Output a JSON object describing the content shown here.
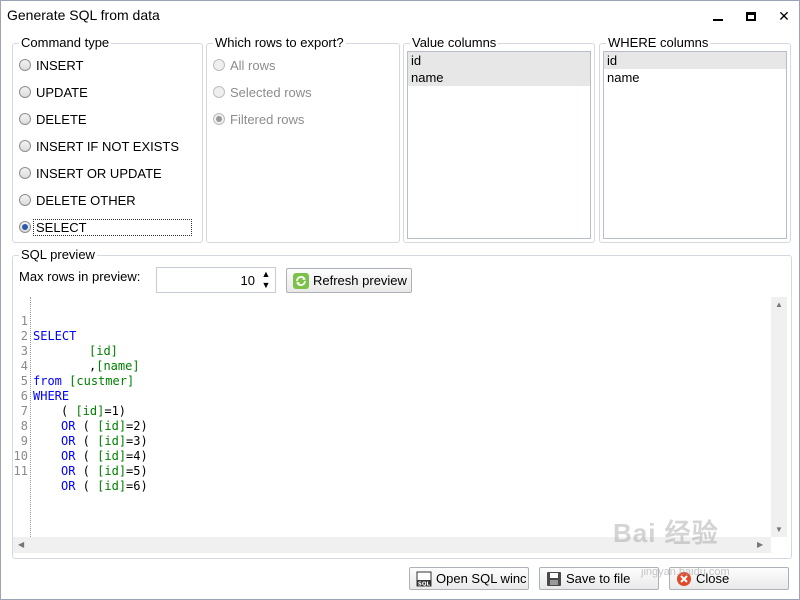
{
  "window": {
    "title": "Generate SQL from data"
  },
  "command_type": {
    "title": "Command type",
    "options": [
      "INSERT",
      "UPDATE",
      "DELETE",
      "INSERT IF NOT EXISTS",
      "INSERT OR UPDATE",
      "DELETE OTHER",
      "SELECT"
    ],
    "selected": "SELECT"
  },
  "rows_export": {
    "title": "Which rows to export?",
    "options": [
      "All rows",
      "Selected rows",
      "Filtered rows"
    ],
    "selected": "Filtered rows"
  },
  "value_columns": {
    "title": "Value columns",
    "items": [
      "id",
      "name"
    ]
  },
  "where_columns": {
    "title": "WHERE columns",
    "items": [
      "id",
      "name"
    ]
  },
  "sql_preview": {
    "title": "SQL preview",
    "max_rows_label": "Max rows in preview:",
    "max_rows_value": "10",
    "refresh_label": "Refresh preview",
    "line_numbers": [
      "1",
      "2",
      "3",
      "4",
      "5",
      "6",
      "7",
      "8",
      "9",
      "10",
      "11"
    ],
    "code": {
      "l1_kw": "SELECT",
      "l2_id": "[id]",
      "l3_pre": ",",
      "l3_id": "[name]",
      "l4_kw": "from",
      "l4_id": "[custmer]",
      "l5_kw": "WHERE",
      "l6_pre": "( ",
      "l6_id": "[id]",
      "l6_post": "=1)",
      "or_kw": "OR",
      "or_pre": " ( ",
      "l7_id": "[id]",
      "l7_post": "=2)",
      "l8_id": "[id]",
      "l8_post": "=3)",
      "l9_id": "[id]",
      "l9_post": "=4)",
      "l10_id": "[id]",
      "l10_post": "=5)",
      "l11_id": "[id]",
      "l11_post": "=6)"
    }
  },
  "footer": {
    "open_sql_label": "Open SQL winc",
    "save_label": "Save to file",
    "close_label": "Close"
  },
  "watermark": {
    "text": "Bai 经验",
    "sub": "jingyan.baidu.com"
  }
}
